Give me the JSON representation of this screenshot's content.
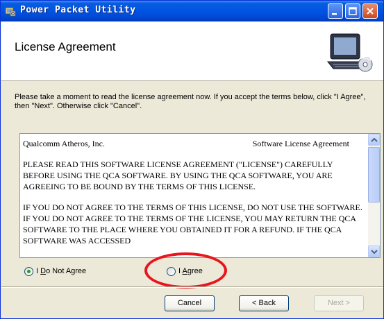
{
  "window": {
    "title": "Power Packet Utility"
  },
  "header": {
    "title": "License Agreement",
    "graphic": "computer-disc-icon"
  },
  "instructions": "Please take a moment to read the license agreement now. If you accept the terms below, click \"I Agree\", then \"Next\". Otherwise click \"Cancel\".",
  "license": {
    "company": "Qualcomm Atheros, Inc.",
    "doc_title": "Software License Agreement",
    "para1": "PLEASE READ THIS SOFTWARE LICENSE AGREEMENT (\"LICENSE\") CAREFULLY BEFORE USING THE QCA SOFTWARE.  BY USING THE QCA SOFTWARE, YOU ARE AGREEING TO BE BOUND BY THE TERMS OF THIS LICENSE.",
    "para2": "IF YOU DO NOT AGREE TO THE TERMS OF THIS LICENSE, DO NOT USE THE SOFTWARE.  IF YOU DO NOT AGREE TO THE TERMS OF THE LICENSE, YOU MAY RETURN THE QCA SOFTWARE TO THE PLACE WHERE YOU OBTAINED IT FOR A REFUND.  IF THE QCA SOFTWARE WAS ACCESSED"
  },
  "options": {
    "disagree_prefix": "I ",
    "disagree_key": "D",
    "disagree_rest": "o Not Agree",
    "agree_prefix": "I ",
    "agree_key": "A",
    "agree_rest": "gree",
    "selected": "I Do Not Agree"
  },
  "buttons": {
    "cancel": "Cancel",
    "back": "< Back",
    "next": "Next >"
  },
  "colors": {
    "annotation_circle": "#e8151c",
    "titlebar": "#0055e5"
  }
}
